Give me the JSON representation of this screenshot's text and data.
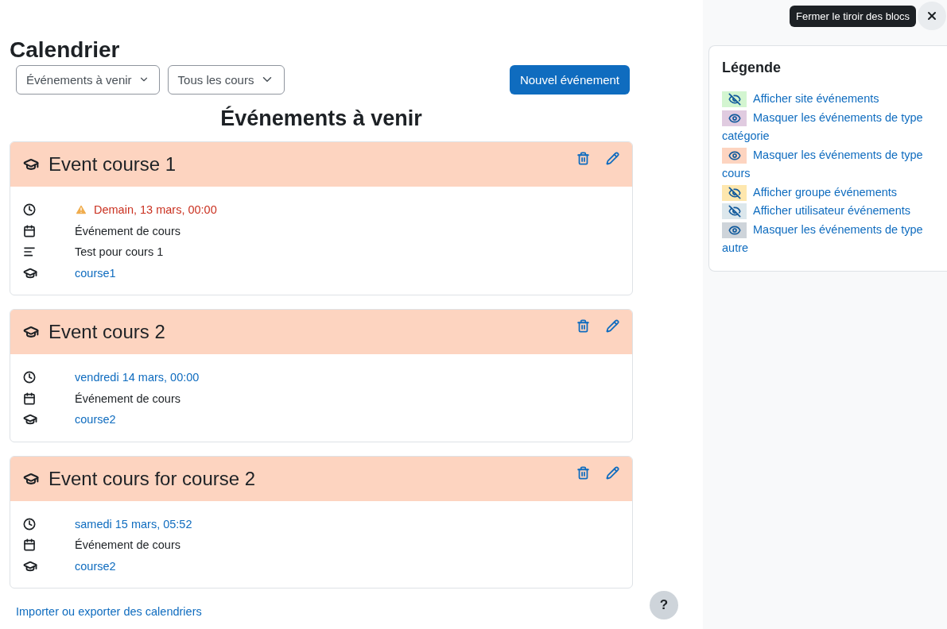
{
  "page_title": "Calendrier",
  "filters": [
    {
      "label": "Événements à venir"
    },
    {
      "label": "Tous les cours"
    }
  ],
  "new_event_button": "Nouvel événement",
  "heading": "Événements à venir",
  "events": [
    {
      "title": "Event course 1",
      "rows": [
        {
          "kind": "time",
          "text": "Demain, 13 mars, 00:00",
          "warning": true
        },
        {
          "kind": "type",
          "text": "Événement de cours"
        },
        {
          "kind": "description",
          "text": "Test pour cours 1"
        },
        {
          "kind": "course",
          "text": "course1"
        }
      ]
    },
    {
      "title": "Event cours 2",
      "rows": [
        {
          "kind": "time",
          "text": "vendredi 14 mars, 00:00",
          "warning": false
        },
        {
          "kind": "type",
          "text": "Événement de cours"
        },
        {
          "kind": "course",
          "text": "course2"
        }
      ]
    },
    {
      "title": "Event cours for course 2",
      "rows": [
        {
          "kind": "time",
          "text": "samedi 15 mars, 05:52",
          "warning": false
        },
        {
          "kind": "type",
          "text": "Événement de cours"
        },
        {
          "kind": "course",
          "text": "course2"
        }
      ]
    }
  ],
  "import_link": "Importer ou exporter des calendriers",
  "help_button": "?",
  "drawer": {
    "tooltip": "Fermer le tiroir des blocs",
    "legend": {
      "title": "Légende",
      "items": [
        {
          "label": "Afficher site événements",
          "color": "#d3f5d0",
          "hidden": true
        },
        {
          "label": "Masquer les événements de type catégorie",
          "color": "#e0cbe0",
          "hidden": false
        },
        {
          "label": "Masquer les événements de type cours",
          "color": "#fdd4c0",
          "hidden": false
        },
        {
          "label": "Afficher groupe événements",
          "color": "#fee7ae",
          "hidden": true
        },
        {
          "label": "Afficher utilisateur événements",
          "color": "#dce7ec",
          "hidden": true
        },
        {
          "label": "Masquer les événements de type autre",
          "color": "#ced4da",
          "hidden": false
        }
      ]
    }
  }
}
